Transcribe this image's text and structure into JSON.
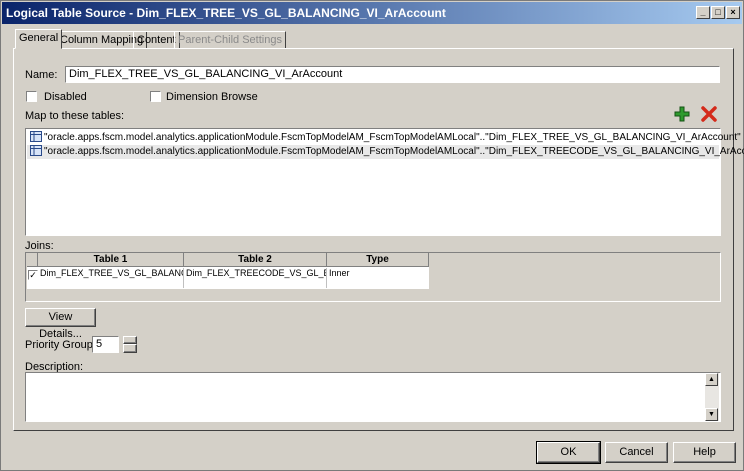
{
  "window": {
    "title": "Logical Table Source - Dim_FLEX_TREE_VS_GL_BALANCING_VI_ArAccount",
    "min_glyph": "_",
    "max_glyph": "□",
    "close_glyph": "×"
  },
  "tabs": [
    {
      "label": "General",
      "active": true
    },
    {
      "label": "Column Mapping"
    },
    {
      "label": "Content"
    },
    {
      "label": "Parent-Child Settings",
      "disabled": true
    }
  ],
  "name_label": "Name:",
  "name_value": "Dim_FLEX_TREE_VS_GL_BALANCING_VI_ArAccount",
  "disabled_label": "Disabled",
  "dimension_browse_label": "Dimension Browse",
  "map_label": "Map to these tables:",
  "map_tables": [
    "\"oracle.apps.fscm.model.analytics.applicationModule.FscmTopModelAM_FscmTopModelAMLocal\"..\"Dim_FLEX_TREE_VS_GL_BALANCING_VI_ArAccount\"",
    "\"oracle.apps.fscm.model.analytics.applicationModule.FscmTopModelAM_FscmTopModelAMLocal\"..\"Dim_FLEX_TREECODE_VS_GL_BALANCING_VI_ArAccount\""
  ],
  "joins_label": "Joins:",
  "joins_headers": [
    "Table 1",
    "Table 2",
    "Type"
  ],
  "joins_rows": [
    {
      "checked": true,
      "table1": "Dim_FLEX_TREE_VS_GL_BALANCING_VI_ArAccount",
      "table2": "Dim_FLEX_TREECODE_VS_GL_BALANCING_VI_ArAccount",
      "type": "Inner"
    }
  ],
  "view_details_label": "View Details...",
  "priority_label": "Priority Group:",
  "priority_value": "5",
  "description_label": "Description:",
  "buttons": {
    "ok": "OK",
    "cancel": "Cancel",
    "help": "Help"
  },
  "colors": {
    "title_start": "#0a246a",
    "title_end": "#a6caf0",
    "add_icon": "#2e9a2e",
    "delete_icon": "#d42a1a",
    "selected_row": "#e8e8e8"
  }
}
